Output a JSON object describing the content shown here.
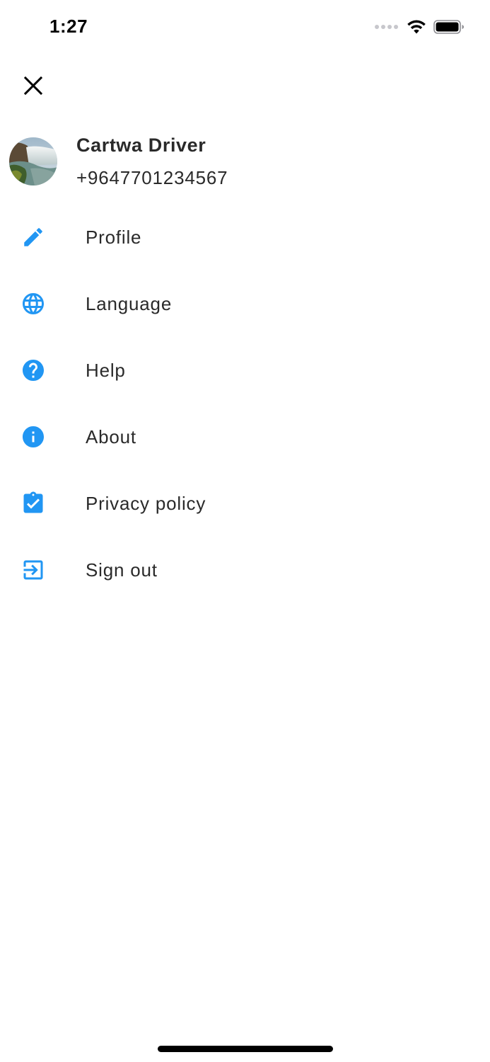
{
  "status_bar": {
    "time": "1:27",
    "signal_icon": "cellular-dots-icon",
    "wifi_icon": "wifi-icon",
    "battery_icon": "battery-icon"
  },
  "close": {
    "icon": "close-icon"
  },
  "user": {
    "name": "Cartwa Driver",
    "phone": "+9647701234567",
    "avatar_icon": "waterfall-avatar-image"
  },
  "menu": {
    "items": [
      {
        "label": "Profile",
        "icon": "pencil-icon"
      },
      {
        "label": "Language",
        "icon": "globe-icon"
      },
      {
        "label": "Help",
        "icon": "help-circle-icon"
      },
      {
        "label": "About",
        "icon": "info-circle-icon"
      },
      {
        "label": "Privacy policy",
        "icon": "clipboard-check-icon"
      },
      {
        "label": "Sign out",
        "icon": "sign-out-icon"
      }
    ]
  },
  "colors": {
    "accent": "#2196F3",
    "text": "#2A2A2A",
    "background": "#FFFFFF"
  }
}
